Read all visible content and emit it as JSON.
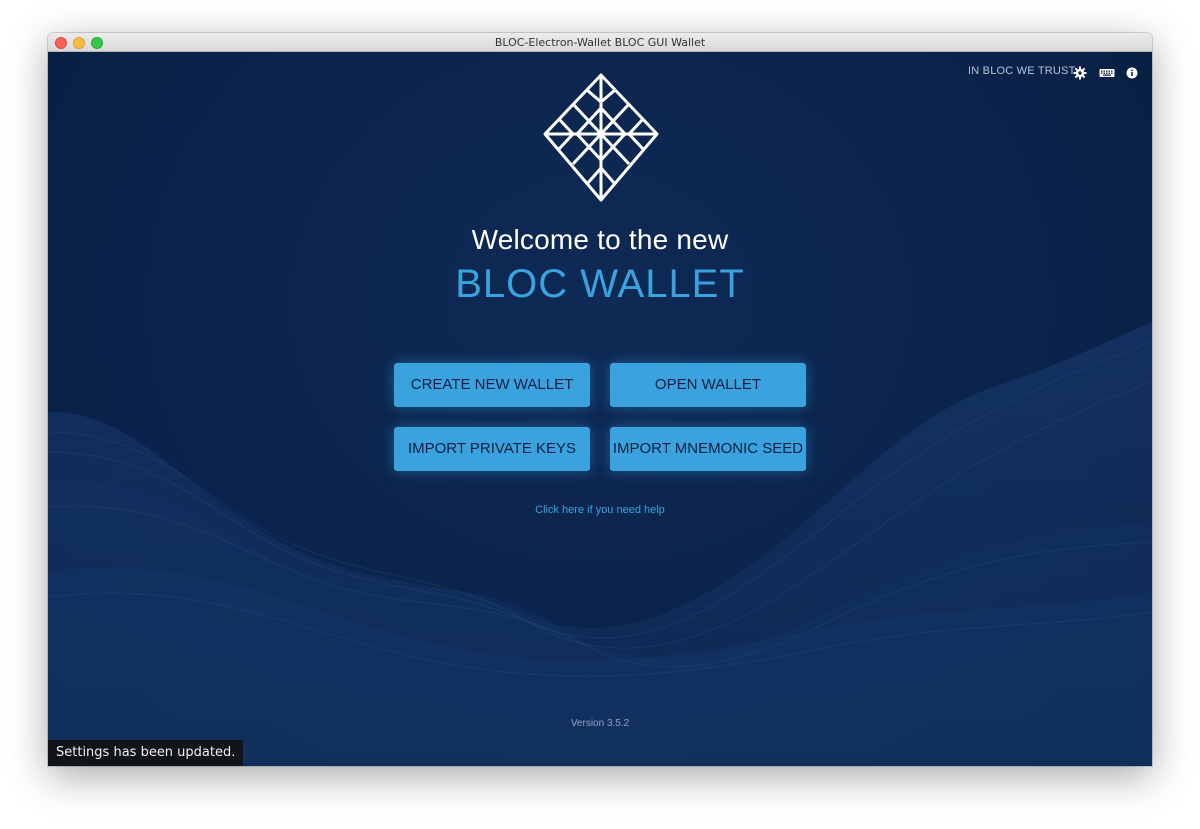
{
  "window": {
    "title": "BLOC-Electron-Wallet BLOC GUI Wallet"
  },
  "header": {
    "tagline": "IN BLOC WE TRUST",
    "icons": [
      "gear-icon",
      "keyboard-icon",
      "info-icon"
    ]
  },
  "welcome": {
    "line1": "Welcome to the new",
    "line2": "BLOC WALLET"
  },
  "actions": {
    "create": "CREATE NEW WALLET",
    "open": "OPEN WALLET",
    "import_keys": "IMPORT PRIVATE KEYS",
    "import_seed": "IMPORT MNEMONIC SEED"
  },
  "help_link": "Click here if you need help",
  "version": "Version 3.5.2",
  "toast": "Settings has been updated.",
  "colors": {
    "background": "#0a234a",
    "accent": "#3aa3df",
    "button_text": "#0b1f3f"
  }
}
